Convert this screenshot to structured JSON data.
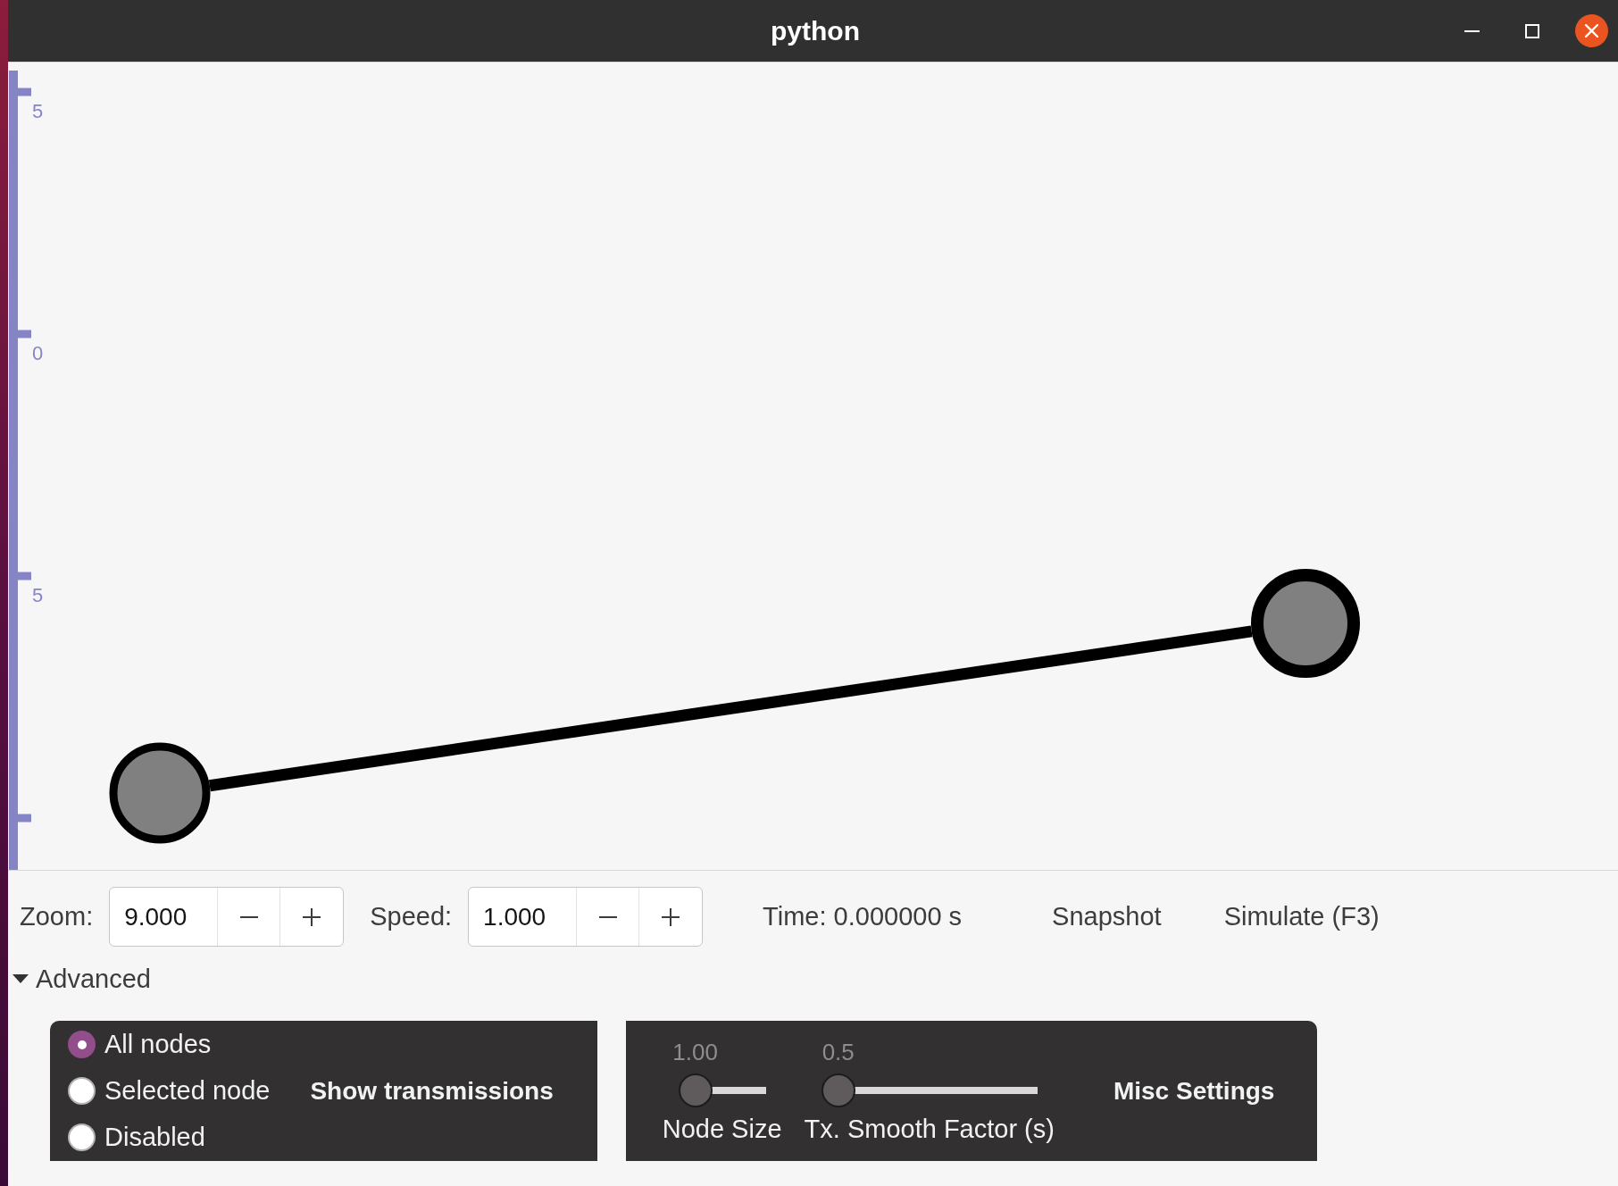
{
  "window": {
    "title": "python"
  },
  "canvas": {
    "axis_ticks": [
      {
        "kind": "labeled",
        "label": "5"
      },
      {
        "kind": "labeled",
        "label": "0"
      },
      {
        "kind": "labeled",
        "label": "5"
      },
      {
        "kind": "bare"
      }
    ],
    "nodes": [
      {
        "selected": false
      },
      {
        "selected": true
      }
    ],
    "links": [
      {
        "kind": "wired"
      }
    ]
  },
  "toolbar": {
    "spinners": [
      {
        "label": "Zoom:",
        "value": "9.000"
      },
      {
        "label": "Speed:",
        "value": "1.000"
      }
    ],
    "time": "Time: 0.000000 s",
    "buttons": [
      "Snapshot",
      "Simulate (F3)"
    ]
  },
  "advanced": {
    "label": "Advanced",
    "expanded": true
  },
  "transmissions": {
    "options": [
      {
        "label": "All nodes",
        "selected": true
      },
      {
        "label": "Selected node",
        "selected": false
      },
      {
        "label": "Disabled",
        "selected": false
      }
    ],
    "title": "Show transmissions"
  },
  "misc_settings": {
    "sliders": [
      {
        "value": "1.00",
        "label": "Node Size",
        "level": 0
      },
      {
        "value": "0.5",
        "label": "Tx. Smooth Factor (s)",
        "level": 0
      }
    ],
    "title": "Misc Settings"
  }
}
